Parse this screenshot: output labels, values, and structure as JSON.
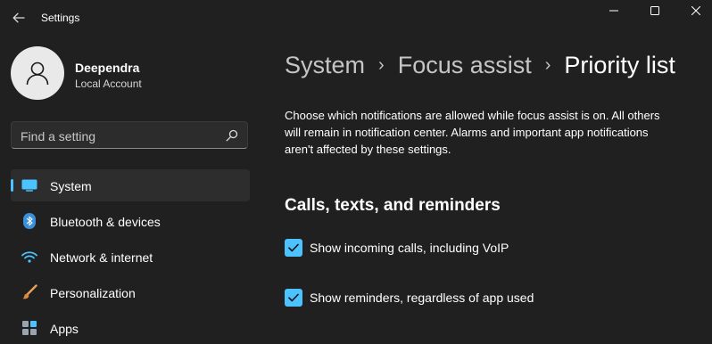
{
  "window": {
    "title": "Settings",
    "controls": {
      "minimize": "minimize-icon",
      "maximize": "maximize-icon",
      "close": "close-icon"
    }
  },
  "profile": {
    "name": "Deependra",
    "subtitle": "Local Account"
  },
  "search": {
    "placeholder": "Find a setting"
  },
  "sidebar": {
    "items": [
      {
        "label": "System",
        "icon": "monitor-icon",
        "active": true
      },
      {
        "label": "Bluetooth & devices",
        "icon": "bluetooth-icon",
        "active": false
      },
      {
        "label": "Network & internet",
        "icon": "wifi-icon",
        "active": false
      },
      {
        "label": "Personalization",
        "icon": "brush-icon",
        "active": false
      },
      {
        "label": "Apps",
        "icon": "apps-icon",
        "active": false
      }
    ]
  },
  "breadcrumb": {
    "items": [
      "System",
      "Focus assist"
    ],
    "current": "Priority list"
  },
  "main": {
    "description": "Choose which notifications are allowed while focus assist is on. All others will remain in notification center. Alarms and important app notifications aren't affected by these settings.",
    "section_title": "Calls, texts, and reminders",
    "options": [
      {
        "label": "Show incoming calls, including VoIP",
        "checked": true
      },
      {
        "label": "Show reminders, regardless of app used",
        "checked": true
      }
    ]
  },
  "colors": {
    "background": "#202020",
    "accent": "#4cc2ff",
    "sidebar_active": "#2d2d2d"
  }
}
